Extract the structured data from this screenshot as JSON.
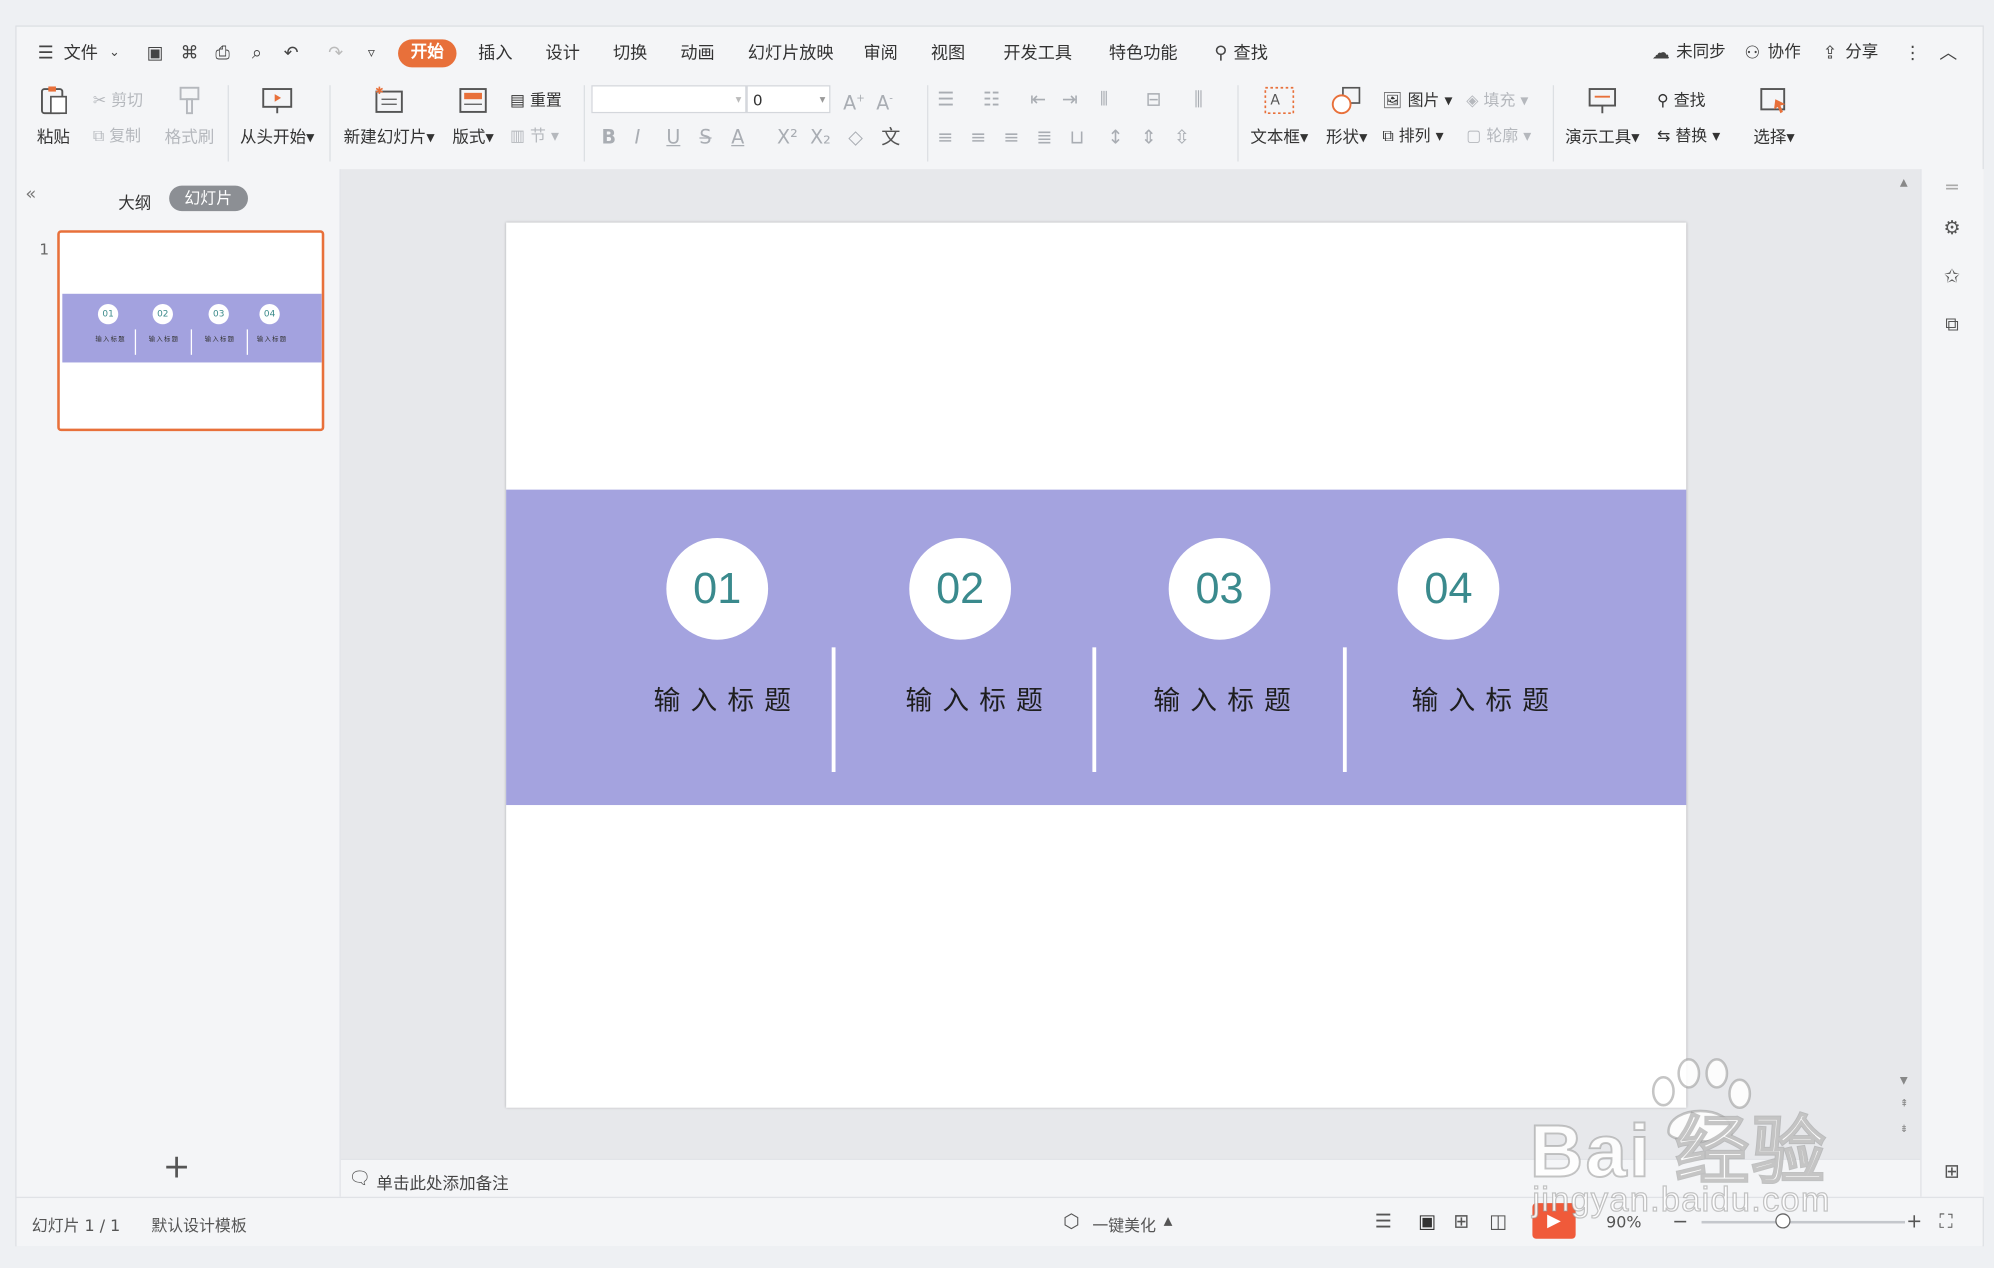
{
  "menubar": {
    "file_label": "文件",
    "tabs": [
      "开始",
      "插入",
      "设计",
      "切换",
      "动画",
      "幻灯片放映",
      "审阅",
      "视图",
      "开发工具",
      "特色功能"
    ],
    "search_label": "查找",
    "unsynced_label": "未同步",
    "collab_label": "协作",
    "share_label": "分享"
  },
  "ribbon": {
    "paste": "粘贴",
    "cut": "剪切",
    "copy": "复制",
    "format_painter": "格式刷",
    "from_start": "从头开始",
    "new_slide": "新建幻灯片",
    "layout": "版式",
    "reset": "重置",
    "section": "节",
    "font_size_value": "0",
    "textbox": "文本框",
    "shape": "形状",
    "picture": "图片",
    "fill": "填充",
    "arrange": "排列",
    "outline": "轮廓",
    "present_tools": "演示工具",
    "find": "查找",
    "replace": "替换",
    "select": "选择"
  },
  "left_panel": {
    "tab_outline": "大纲",
    "tab_slides": "幻灯片",
    "slide_number": "1"
  },
  "slide": {
    "band_color": "#a4a3df",
    "number_color": "#3a8a8d",
    "items": [
      {
        "number": "01",
        "title": "输入标题"
      },
      {
        "number": "02",
        "title": "输入标题"
      },
      {
        "number": "03",
        "title": "输入标题"
      },
      {
        "number": "04",
        "title": "输入标题"
      }
    ]
  },
  "notes": {
    "placeholder": "单击此处添加备注"
  },
  "statusbar": {
    "slide_counter": "幻灯片 1 / 1",
    "template": "默认设计模板",
    "beautify": "一键美化",
    "zoom": "90%"
  },
  "watermark": {
    "brand": "Bai  经验",
    "url": "jingyan.baidu.com"
  },
  "colors": {
    "accent": "#e8703a",
    "band": "#a4a3df",
    "number": "#3a8a8d"
  }
}
